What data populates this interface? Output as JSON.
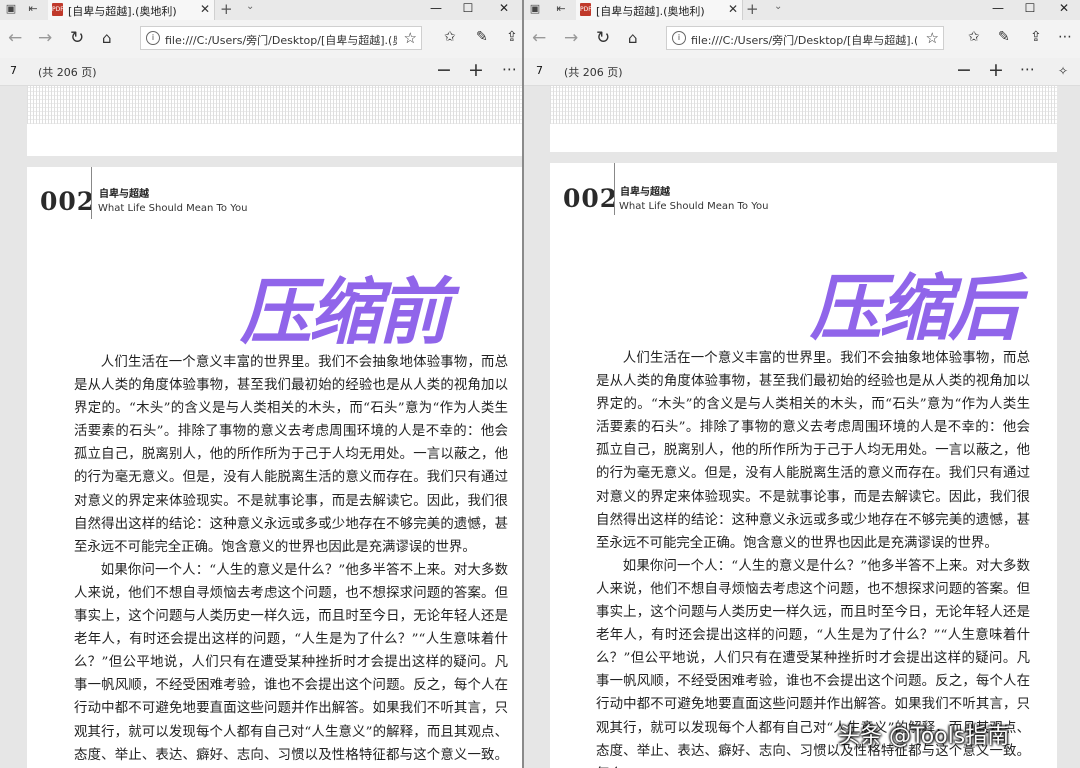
{
  "tab_title": "[自卑与超越].(奥地利)",
  "address_text": "file:///C:/Users/旁门/Desktop/[自卑与超越].(奥地",
  "address_text_right": "file:///C:/Users/旁门/Desktop/[自卑与超越].(奥地",
  "page_number": "7",
  "page_total": "(共 206 页)",
  "book_page_number": "002",
  "book_title_cn": "自卑与超越",
  "book_title_en": "What Life Should Mean To You",
  "label_before": "压缩前",
  "label_after": "压缩后",
  "paragraphs": [
    "人们生活在一个意义丰富的世界里。我们不会抽象地体验事物，而总是从人类的角度体验事物，甚至我们最初始的经验也是从人类的视角加以界定的。“木头”的含义是与人类相关的木头，而“石头”意为“作为人类生活要素的石头”。排除了事物的意义去考虑周围环境的人是不幸的：他会孤立自己，脱离别人，他的所作所为于己于人均无用处。一言以蔽之，他的行为毫无意义。但是，没有人能脱离生活的意义而存在。我们只有通过对意义的界定来体验现实。不是就事论事，而是去解读它。因此，我们很自然得出这样的结论：这种意义永远或多或少地存在不够完美的遗憾，甚至永远不可能完全正确。饱含意义的世界也因此是充满谬误的世界。",
    "如果你问一个人：“人生的意义是什么？”他多半答不上来。对大多数人来说，他们不想自寻烦恼去考虑这个问题，也不想探求问题的答案。但事实上，这个问题与人类历史一样久远，而且时至今日，无论年轻人还是老年人，有时还会提出这样的问题，“人生是为了什么？”“人生意味着什么？”但公平地说，人们只有在遭受某种挫折时才会提出这样的疑问。凡事一帆风顺，不经受困难考验，谁也不会提出这个问题。反之，每个人在行动中都不可避免地要直面这些问题并作出解答。如果我们不听其言，只观其行，就可以发现每个人都有自己对“人生意义”的解释，而且其观点、态度、举止、表达、癖好、志向、习惯以及性格特征都与这个意义一致。每个"
  ],
  "watermark": "头条 @Tools指南"
}
